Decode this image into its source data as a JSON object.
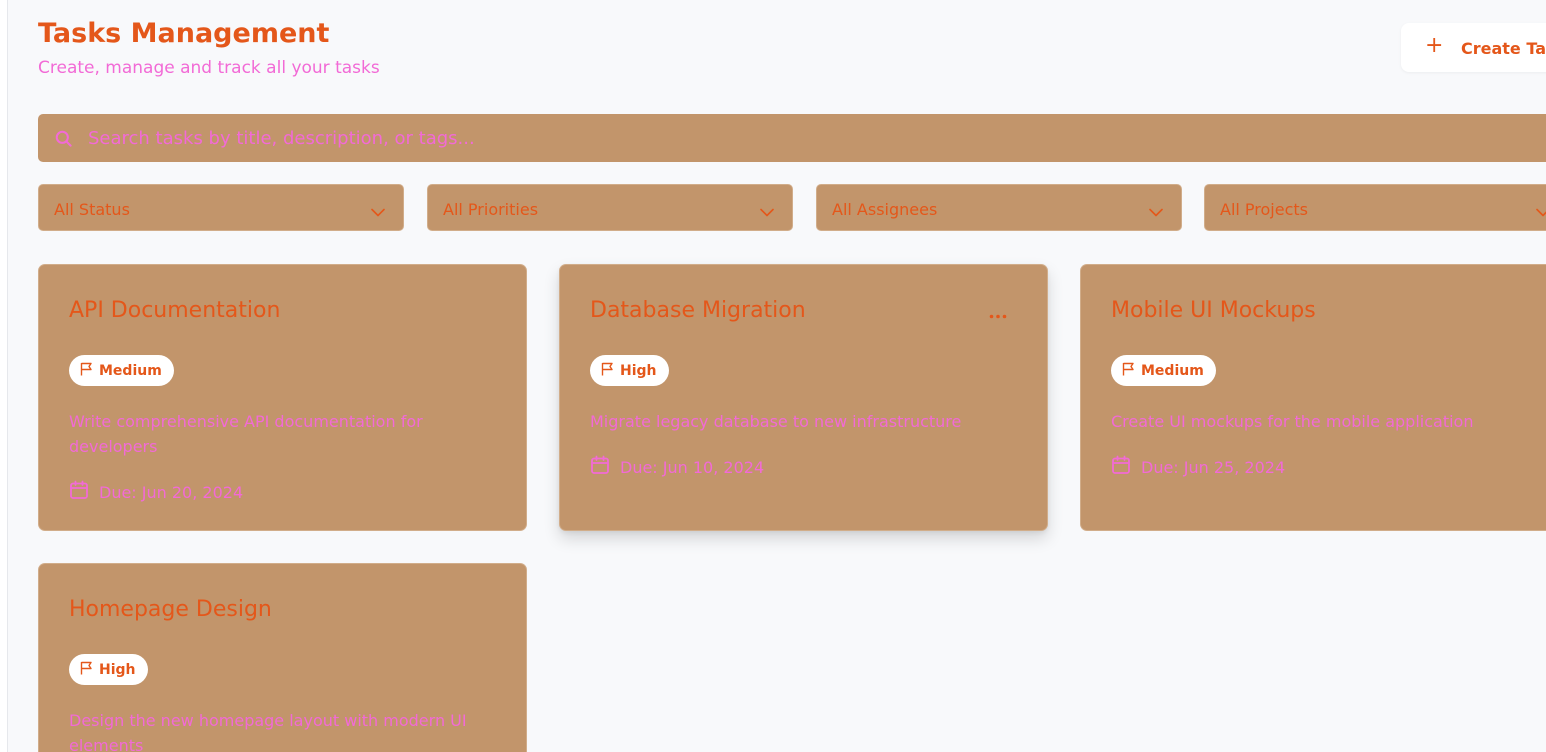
{
  "header": {
    "title": "Tasks Management",
    "subtitle": "Create, manage and track all your tasks",
    "create_button": "Create Task"
  },
  "search": {
    "placeholder": "Search tasks by title, description, or tags..."
  },
  "filters": [
    {
      "label": "All Status"
    },
    {
      "label": "All Priorities"
    },
    {
      "label": "All Assignees"
    },
    {
      "label": "All Projects"
    }
  ],
  "tasks": [
    {
      "title": "API Documentation",
      "priority": "Medium",
      "description": "Write comprehensive API documentation for developers",
      "due": "Due: Jun 20, 2024"
    },
    {
      "title": "Database Migration",
      "priority": "High",
      "description": "Migrate legacy database to new infrastructure",
      "due": "Due: Jun 10, 2024"
    },
    {
      "title": "Mobile UI Mockups",
      "priority": "Medium",
      "description": "Create UI mockups for the mobile application",
      "due": "Due: Jun 25, 2024"
    },
    {
      "title": "Homepage Design",
      "priority": "High",
      "description": "Design the new homepage layout with modern UI elements",
      "due": ""
    }
  ],
  "colors": {
    "accent": "#e4571a",
    "pink": "#f26ad6",
    "card": "#c2956b",
    "background": "#f8f9fb"
  },
  "icons": {
    "create": "plus-icon",
    "search": "search-icon",
    "filter": "chevron-down-icon",
    "priority": "flag-icon",
    "due": "calendar-icon",
    "menu": "more-horizontal-icon"
  }
}
